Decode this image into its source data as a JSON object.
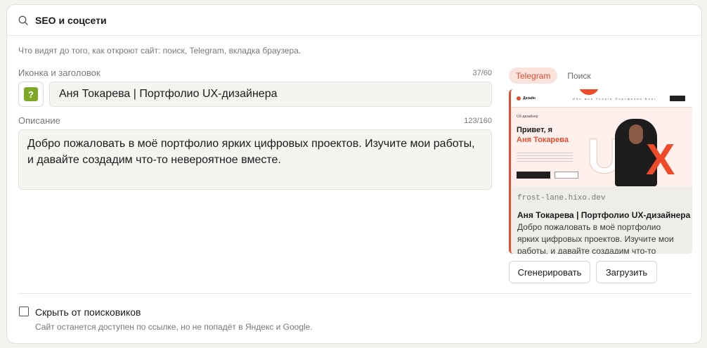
{
  "panel": {
    "title": "SEO и соцсети",
    "hint": "Что видят до того, как откроют сайт: поиск, Telegram, вкладка браузера."
  },
  "icon_title": {
    "label": "Иконка и заголовок",
    "counter": "37/60",
    "favicon_glyph": "?",
    "value": "Аня Токарева | Портфолио UX-дизайнера"
  },
  "description": {
    "label": "Описание",
    "counter": "123/160",
    "value": "Добро пожаловать в моё портфолио ярких цифровых проектов. Изучите мои работы, и давайте создадим что-то невероятное вместе."
  },
  "preview": {
    "tabs": [
      {
        "label": "Telegram",
        "active": true
      },
      {
        "label": "Поиск",
        "active": false
      }
    ],
    "domain": "frost-lane.hixo.dev",
    "title": "Аня Токарева | Портфолио UX-дизайнера",
    "description": "Добро пожаловать в моё портфолио ярких цифровых проектов. Изучите мои работы, и давайте создадим что-то невероятное…",
    "thumb": {
      "logo": "Дизайн",
      "links": "Обо мне  Услуги  Портфолио  Блог",
      "subtitle": "UX-дизайнер",
      "heading_line1": "Привет, я",
      "heading_line2": "Аня Токарева",
      "big_letter_u": "U",
      "big_letter_x": "X"
    }
  },
  "actions": {
    "generate": "Сгенерировать",
    "upload": "Загрузить"
  },
  "hide": {
    "label": "Скрыть от поисковиков",
    "hint": "Сайт останется доступен по ссылке, но не попадёт в Яндекс и Google.",
    "checked": false
  },
  "colors": {
    "accent": "#e24d2f",
    "favicon_bg": "#7fa829"
  }
}
